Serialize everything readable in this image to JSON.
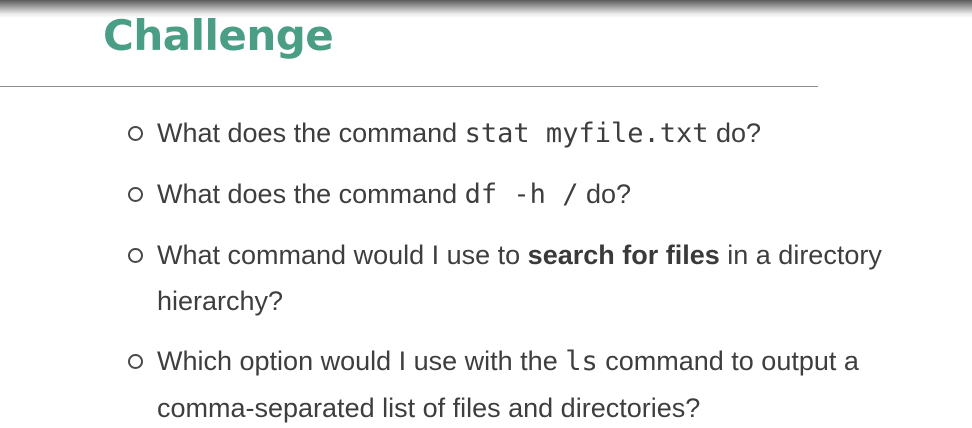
{
  "slide": {
    "title": "Challenge"
  },
  "bullets": [
    {
      "pre": "What does the command ",
      "code": "stat myfile.txt",
      "post": " do?"
    },
    {
      "pre": "What does the command ",
      "code": "df -h /",
      "post": " do?"
    },
    {
      "pre": "What command would I use to ",
      "bold": "search for files",
      "post": " in a directory hierarchy?"
    },
    {
      "pre": "Which option would I use with the ",
      "code": "ls",
      "post": " command to output a comma-separated list of files and directories?"
    }
  ],
  "colors": {
    "title": "#4a9e86",
    "text": "#3e3e3e",
    "rule": "#8c8c8c"
  }
}
